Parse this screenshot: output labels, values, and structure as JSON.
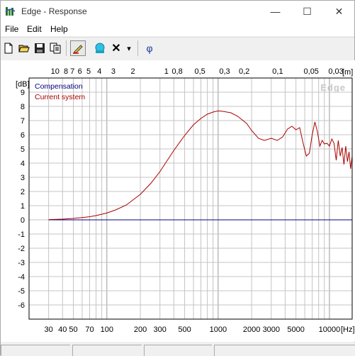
{
  "window": {
    "title": "Edge - Response",
    "minimize_glyph": "—",
    "maximize_glyph": "☐",
    "close_glyph": "✕"
  },
  "menu": {
    "items": [
      "File",
      "Edit",
      "Help"
    ]
  },
  "toolbar": {
    "buttons": [
      "new-document-icon",
      "open-folder-icon",
      "save-icon",
      "copy-icon",
      "pencil-icon",
      "speaker-icon",
      "delete-icon",
      "dropdown-arrow-icon",
      "phi-icon"
    ],
    "phi_label": "φ",
    "delete_label": "✕",
    "dropdown_label": "▾"
  },
  "chart_data": {
    "type": "line",
    "watermark": "Edge",
    "ylabel": "[dB]",
    "xlabel": "[Hz]",
    "top_axis_label": "[m]",
    "x_scale": "log",
    "xlim": [
      20,
      16000
    ],
    "ylim": [
      -7,
      10
    ],
    "y_ticks": [
      9,
      8,
      7,
      6,
      5,
      4,
      3,
      2,
      1,
      0,
      -1,
      -2,
      -3,
      -4,
      -5,
      -6
    ],
    "x_tick_labels": [
      {
        "label": "30",
        "x": 30
      },
      {
        "label": "40",
        "x": 40
      },
      {
        "label": "50",
        "x": 50
      },
      {
        "label": "70",
        "x": 70
      },
      {
        "label": "100",
        "x": 100
      },
      {
        "label": "200",
        "x": 200
      },
      {
        "label": "300",
        "x": 300
      },
      {
        "label": "500",
        "x": 500
      },
      {
        "label": "1000",
        "x": 1000
      },
      {
        "label": "2000",
        "x": 2000
      },
      {
        "label": "3000",
        "x": 3000
      },
      {
        "label": "5000",
        "x": 5000
      },
      {
        "label": "10000",
        "x": 10000
      }
    ],
    "top_tick_labels": [
      {
        "label": "10",
        "x": 34.3
      },
      {
        "label": "8",
        "x": 42.9
      },
      {
        "label": "7",
        "x": 49
      },
      {
        "label": "6",
        "x": 57.2
      },
      {
        "label": "5",
        "x": 68.6
      },
      {
        "label": "4",
        "x": 85.8
      },
      {
        "label": "3",
        "x": 114.3
      },
      {
        "label": "2",
        "x": 171.5
      },
      {
        "label": "1",
        "x": 343
      },
      {
        "label": "0,8",
        "x": 428.8
      },
      {
        "label": "0,5",
        "x": 686
      },
      {
        "label": "0,3",
        "x": 1143
      },
      {
        "label": "0,2",
        "x": 1715
      },
      {
        "label": "0,1",
        "x": 3430
      },
      {
        "label": "0,05",
        "x": 6860
      },
      {
        "label": "0,03",
        "x": 11433
      }
    ],
    "series": [
      {
        "name": "Compensation",
        "color": "#000080",
        "x": [
          30,
          16000
        ],
        "y": [
          0,
          0
        ]
      },
      {
        "name": "Current system",
        "color": "#aa0000",
        "x": [
          30,
          40,
          50,
          60,
          70,
          80,
          100,
          120,
          150,
          200,
          250,
          300,
          400,
          500,
          600,
          700,
          800,
          900,
          1000,
          1100,
          1300,
          1500,
          1800,
          2000,
          2300,
          2600,
          3000,
          3400,
          3800,
          4200,
          4600,
          5000,
          5400,
          5800,
          6200,
          6600,
          7000,
          7400,
          7800,
          8200,
          8600,
          9000,
          9500,
          10000,
          10500,
          11000,
          11500,
          12000,
          12500,
          13000,
          13500,
          14000,
          14500,
          15000,
          15500,
          16000
        ],
        "y": [
          0.02,
          0.05,
          0.1,
          0.16,
          0.22,
          0.3,
          0.48,
          0.7,
          1.05,
          1.8,
          2.6,
          3.4,
          4.9,
          5.95,
          6.7,
          7.15,
          7.45,
          7.6,
          7.68,
          7.65,
          7.55,
          7.3,
          6.8,
          6.3,
          5.75,
          5.6,
          5.75,
          5.6,
          5.85,
          6.4,
          6.6,
          6.35,
          6.5,
          5.4,
          4.5,
          4.7,
          6.0,
          6.9,
          6.2,
          5.2,
          5.6,
          5.35,
          5.4,
          5.2,
          5.7,
          5.4,
          4.2,
          5.6,
          4.5,
          5.1,
          3.9,
          5.2,
          4.1,
          4.8,
          3.6,
          4.5
        ]
      }
    ],
    "legend_position": "top-left",
    "grid": true
  }
}
